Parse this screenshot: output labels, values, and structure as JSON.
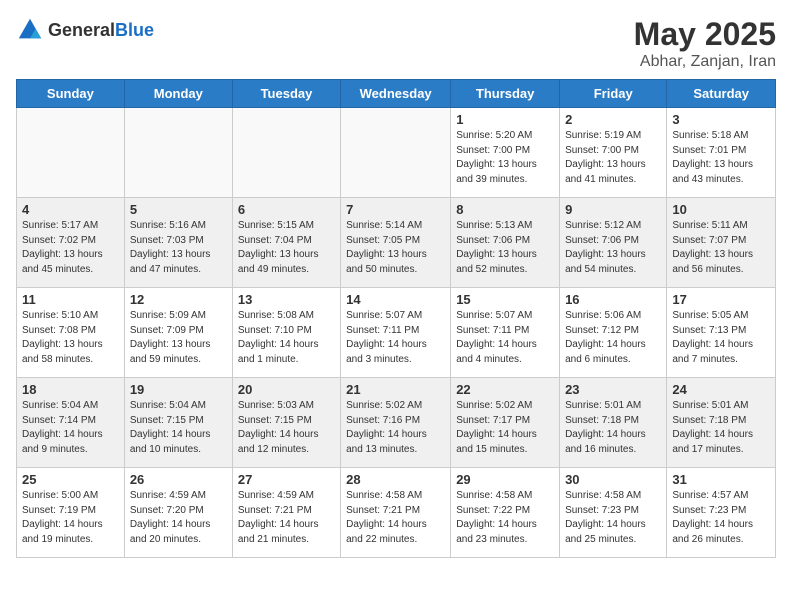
{
  "header": {
    "logo_general": "General",
    "logo_blue": "Blue",
    "month": "May 2025",
    "location": "Abhar, Zanjan, Iran"
  },
  "weekdays": [
    "Sunday",
    "Monday",
    "Tuesday",
    "Wednesday",
    "Thursday",
    "Friday",
    "Saturday"
  ],
  "weeks": [
    [
      {
        "day": "",
        "info": ""
      },
      {
        "day": "",
        "info": ""
      },
      {
        "day": "",
        "info": ""
      },
      {
        "day": "",
        "info": ""
      },
      {
        "day": "1",
        "info": "Sunrise: 5:20 AM\nSunset: 7:00 PM\nDaylight: 13 hours\nand 39 minutes."
      },
      {
        "day": "2",
        "info": "Sunrise: 5:19 AM\nSunset: 7:00 PM\nDaylight: 13 hours\nand 41 minutes."
      },
      {
        "day": "3",
        "info": "Sunrise: 5:18 AM\nSunset: 7:01 PM\nDaylight: 13 hours\nand 43 minutes."
      }
    ],
    [
      {
        "day": "4",
        "info": "Sunrise: 5:17 AM\nSunset: 7:02 PM\nDaylight: 13 hours\nand 45 minutes."
      },
      {
        "day": "5",
        "info": "Sunrise: 5:16 AM\nSunset: 7:03 PM\nDaylight: 13 hours\nand 47 minutes."
      },
      {
        "day": "6",
        "info": "Sunrise: 5:15 AM\nSunset: 7:04 PM\nDaylight: 13 hours\nand 49 minutes."
      },
      {
        "day": "7",
        "info": "Sunrise: 5:14 AM\nSunset: 7:05 PM\nDaylight: 13 hours\nand 50 minutes."
      },
      {
        "day": "8",
        "info": "Sunrise: 5:13 AM\nSunset: 7:06 PM\nDaylight: 13 hours\nand 52 minutes."
      },
      {
        "day": "9",
        "info": "Sunrise: 5:12 AM\nSunset: 7:06 PM\nDaylight: 13 hours\nand 54 minutes."
      },
      {
        "day": "10",
        "info": "Sunrise: 5:11 AM\nSunset: 7:07 PM\nDaylight: 13 hours\nand 56 minutes."
      }
    ],
    [
      {
        "day": "11",
        "info": "Sunrise: 5:10 AM\nSunset: 7:08 PM\nDaylight: 13 hours\nand 58 minutes."
      },
      {
        "day": "12",
        "info": "Sunrise: 5:09 AM\nSunset: 7:09 PM\nDaylight: 13 hours\nand 59 minutes."
      },
      {
        "day": "13",
        "info": "Sunrise: 5:08 AM\nSunset: 7:10 PM\nDaylight: 14 hours\nand 1 minute."
      },
      {
        "day": "14",
        "info": "Sunrise: 5:07 AM\nSunset: 7:11 PM\nDaylight: 14 hours\nand 3 minutes."
      },
      {
        "day": "15",
        "info": "Sunrise: 5:07 AM\nSunset: 7:11 PM\nDaylight: 14 hours\nand 4 minutes."
      },
      {
        "day": "16",
        "info": "Sunrise: 5:06 AM\nSunset: 7:12 PM\nDaylight: 14 hours\nand 6 minutes."
      },
      {
        "day": "17",
        "info": "Sunrise: 5:05 AM\nSunset: 7:13 PM\nDaylight: 14 hours\nand 7 minutes."
      }
    ],
    [
      {
        "day": "18",
        "info": "Sunrise: 5:04 AM\nSunset: 7:14 PM\nDaylight: 14 hours\nand 9 minutes."
      },
      {
        "day": "19",
        "info": "Sunrise: 5:04 AM\nSunset: 7:15 PM\nDaylight: 14 hours\nand 10 minutes."
      },
      {
        "day": "20",
        "info": "Sunrise: 5:03 AM\nSunset: 7:15 PM\nDaylight: 14 hours\nand 12 minutes."
      },
      {
        "day": "21",
        "info": "Sunrise: 5:02 AM\nSunset: 7:16 PM\nDaylight: 14 hours\nand 13 minutes."
      },
      {
        "day": "22",
        "info": "Sunrise: 5:02 AM\nSunset: 7:17 PM\nDaylight: 14 hours\nand 15 minutes."
      },
      {
        "day": "23",
        "info": "Sunrise: 5:01 AM\nSunset: 7:18 PM\nDaylight: 14 hours\nand 16 minutes."
      },
      {
        "day": "24",
        "info": "Sunrise: 5:01 AM\nSunset: 7:18 PM\nDaylight: 14 hours\nand 17 minutes."
      }
    ],
    [
      {
        "day": "25",
        "info": "Sunrise: 5:00 AM\nSunset: 7:19 PM\nDaylight: 14 hours\nand 19 minutes."
      },
      {
        "day": "26",
        "info": "Sunrise: 4:59 AM\nSunset: 7:20 PM\nDaylight: 14 hours\nand 20 minutes."
      },
      {
        "day": "27",
        "info": "Sunrise: 4:59 AM\nSunset: 7:21 PM\nDaylight: 14 hours\nand 21 minutes."
      },
      {
        "day": "28",
        "info": "Sunrise: 4:58 AM\nSunset: 7:21 PM\nDaylight: 14 hours\nand 22 minutes."
      },
      {
        "day": "29",
        "info": "Sunrise: 4:58 AM\nSunset: 7:22 PM\nDaylight: 14 hours\nand 23 minutes."
      },
      {
        "day": "30",
        "info": "Sunrise: 4:58 AM\nSunset: 7:23 PM\nDaylight: 14 hours\nand 25 minutes."
      },
      {
        "day": "31",
        "info": "Sunrise: 4:57 AM\nSunset: 7:23 PM\nDaylight: 14 hours\nand 26 minutes."
      }
    ]
  ]
}
